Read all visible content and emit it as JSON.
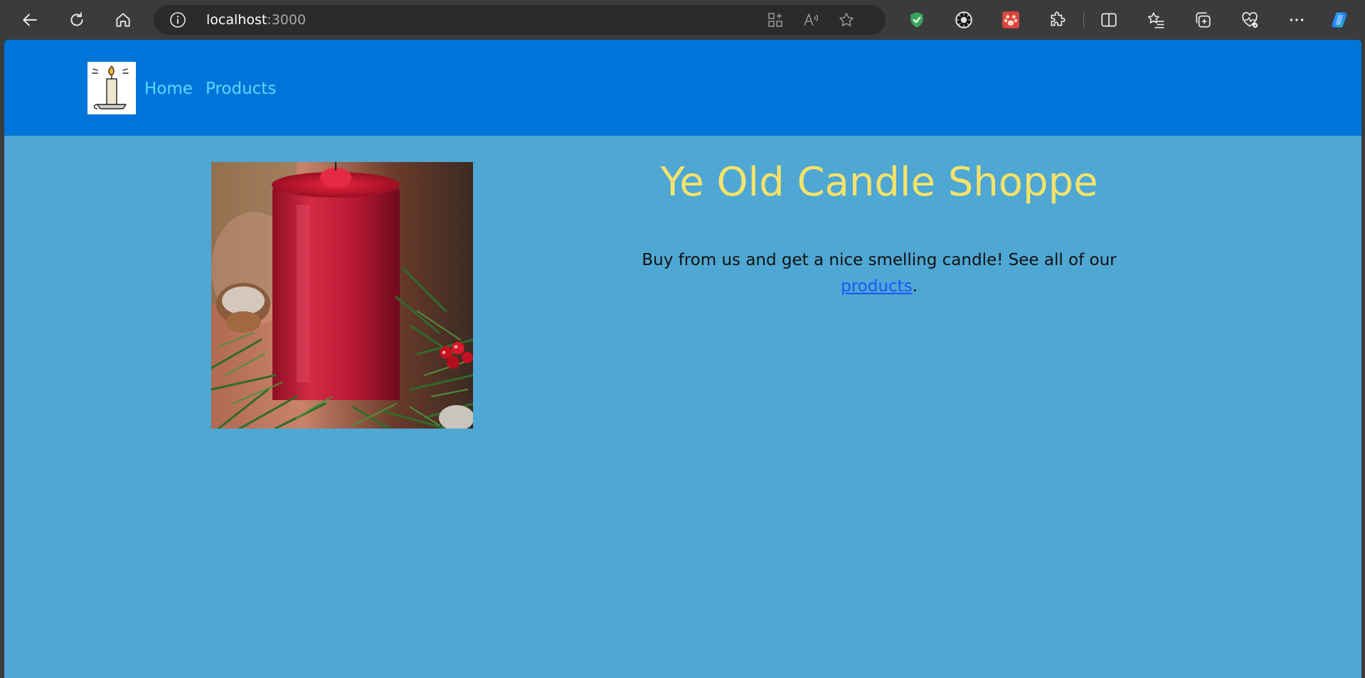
{
  "browser": {
    "url_host": "localhost",
    "url_port": ":3000",
    "icons": {
      "back": "back-arrow-icon",
      "reload": "reload-icon",
      "home": "home-icon",
      "site_info": "info-icon",
      "app_available": "app-grid-icon",
      "read_aloud": "read-aloud-icon",
      "favorite": "star-icon",
      "shield_ext": "shield-check-icon",
      "sun_ext": "sun-burst-icon",
      "paw_ext": "paw-icon",
      "extensions": "puzzle-icon",
      "split_screen": "split-screen-icon",
      "favorites_list": "favorites-list-icon",
      "collections": "collections-icon",
      "health": "browser-essentials-icon",
      "more": "more-icon",
      "copilot": "copilot-icon"
    }
  },
  "site": {
    "nav": {
      "home": "Home",
      "products": "Products"
    },
    "title": "Ye Old Candle Shoppe",
    "intro_text": "Buy from us and get a nice smelling candle! See all of our ",
    "intro_link": "products",
    "intro_end": "."
  },
  "colors": {
    "header_bg": "#0075d9",
    "page_bg": "#4fa7d3",
    "title": "#f6e36a",
    "nav_link": "#5fd8ff",
    "body_link": "#1a56ff"
  }
}
